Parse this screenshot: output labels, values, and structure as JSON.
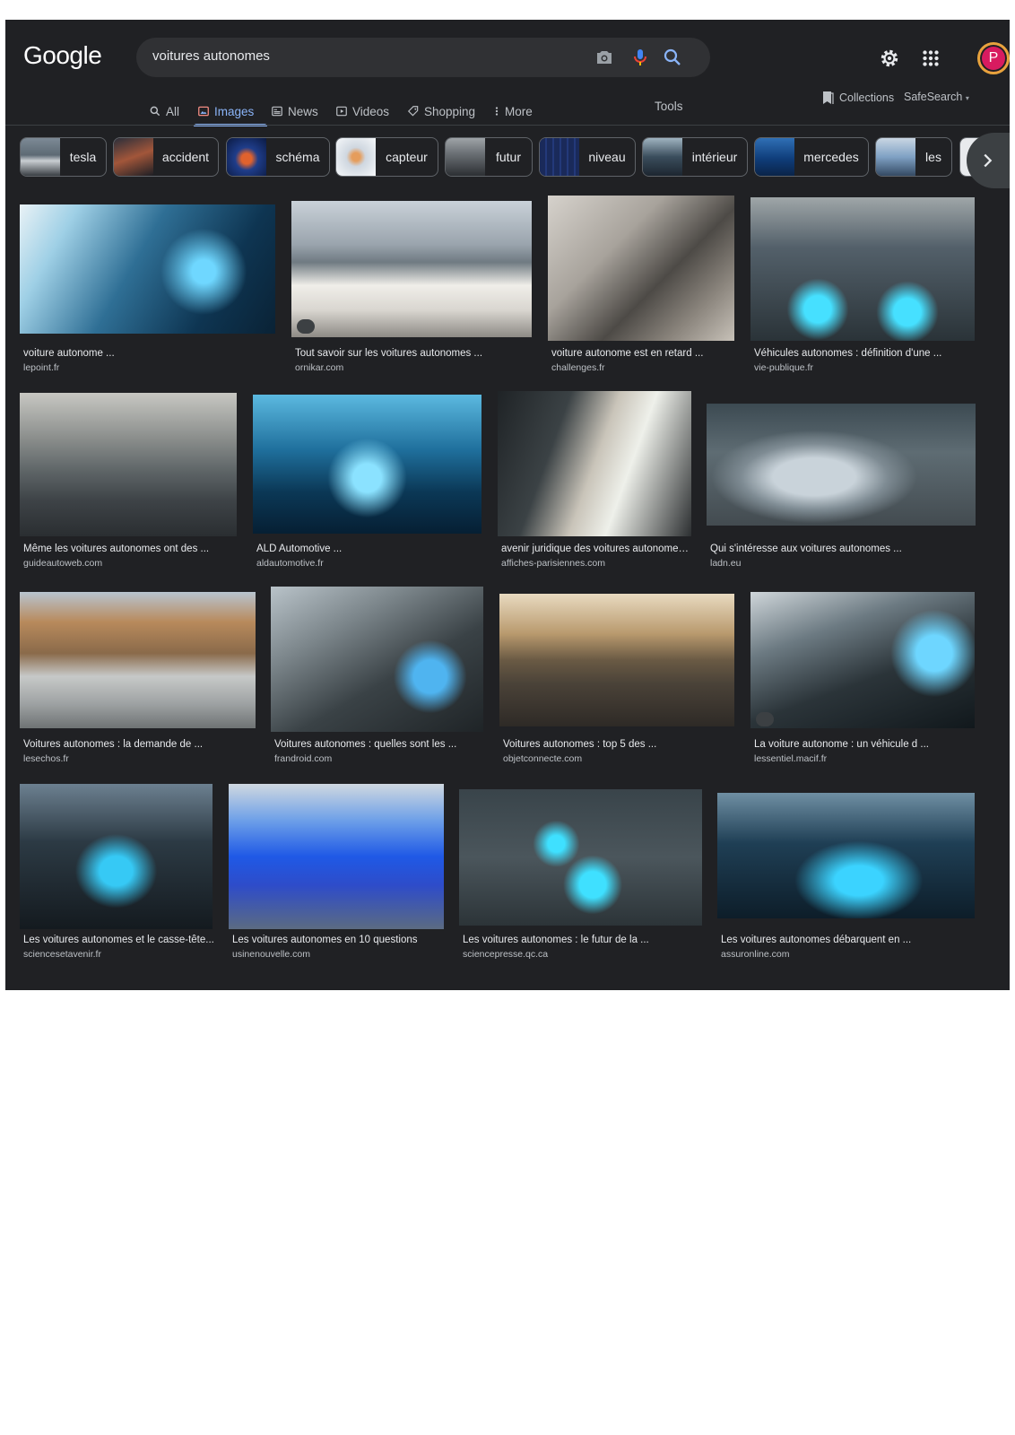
{
  "header": {
    "logo": "Google",
    "search_value": "voitures autonomes"
  },
  "tabs": [
    {
      "label": "All",
      "icon": "search-icon"
    },
    {
      "label": "Images",
      "icon": "image-icon"
    },
    {
      "label": "News",
      "icon": "news-icon"
    },
    {
      "label": "Videos",
      "icon": "play-icon"
    },
    {
      "label": "Shopping",
      "icon": "tag-icon"
    },
    {
      "label": "More",
      "icon": "more-vert-icon"
    }
  ],
  "tools_label": "Tools",
  "collections_label": "Collections",
  "safesearch_label": "SafeSearch",
  "avatar_letter": "P",
  "chips": [
    "tesla",
    "accident",
    "schéma",
    "capteur",
    "futur",
    "niveau",
    "intérieur",
    "mercedes",
    "les"
  ],
  "results": [
    {
      "title": "voiture autonome ...",
      "source": "lepoint.fr"
    },
    {
      "title": "Tout savoir sur les voitures autonomes ...",
      "source": "ornikar.com"
    },
    {
      "title": "voiture autonome est en retard ...",
      "source": "challenges.fr"
    },
    {
      "title": "Véhicules autonomes : définition d'une ...",
      "source": "vie-publique.fr"
    },
    {
      "title": "Même les voitures autonomes ont des ...",
      "source": "guideautoweb.com"
    },
    {
      "title": "ALD Automotive ...",
      "source": "aldautomotive.fr"
    },
    {
      "title": "avenir juridique des voitures autonomes...",
      "source": "affiches-parisiennes.com"
    },
    {
      "title": "Qui s'intéresse aux voitures autonomes ...",
      "source": "ladn.eu"
    },
    {
      "title": "Voitures autonomes : la demande de ...",
      "source": "lesechos.fr"
    },
    {
      "title": "Voitures autonomes : quelles sont les ...",
      "source": "frandroid.com"
    },
    {
      "title": "Voitures autonomes : top 5 des ...",
      "source": "objetconnecte.com"
    },
    {
      "title": "La voiture autonome : un véhicule d ...",
      "source": "lessentiel.macif.fr"
    },
    {
      "title": "Les voitures autonomes et le casse-tête...",
      "source": "sciencesetavenir.fr"
    },
    {
      "title": "Les voitures autonomes en 10 questions",
      "source": "usinenouvelle.com"
    },
    {
      "title": "Les voitures autonomes : le futur de la ...",
      "source": "sciencepresse.qc.ca"
    },
    {
      "title": "Les voitures autonomes débarquent en ...",
      "source": "assuronline.com"
    }
  ],
  "colors": {
    "background": "#202124",
    "search_box": "#303134",
    "accent": "#8ab4f8",
    "text": "#e8eaed",
    "muted": "#bdc1c6",
    "avatar": "#d81b60"
  }
}
